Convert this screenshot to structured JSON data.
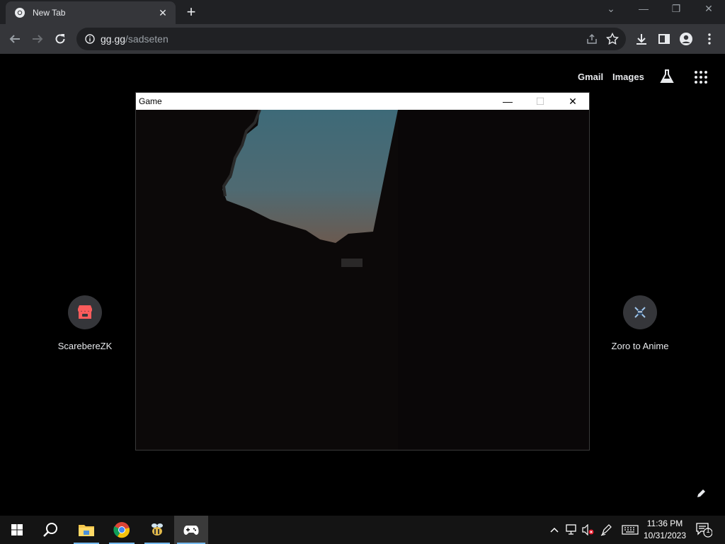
{
  "browser": {
    "tab_title": "New Tab",
    "tab_close": "✕",
    "new_tab": "+",
    "win_controls": {
      "tabsearch": "⌄",
      "minimize": "—",
      "restore": "❐",
      "close": "✕"
    },
    "url_host": "gg.gg",
    "url_path": "/sadseten"
  },
  "ntp": {
    "gmail": "Gmail",
    "images": "Images",
    "shortcuts": [
      {
        "label": "ScarebereZK",
        "icon": "itchio-store-icon"
      },
      {
        "label": "Zoro to Anime",
        "icon": "zoro-anime-icon"
      }
    ]
  },
  "game_window": {
    "title": "Game",
    "minimize": "—",
    "maximize": "☐",
    "close": "✕"
  },
  "taskbar": {
    "time": "11:36 PM",
    "date": "10/31/2023",
    "notification_count": "1"
  },
  "colors": {
    "chrome_dark": "#202124",
    "toolbar": "#35363a",
    "accent_underline": "#76b9ed"
  }
}
